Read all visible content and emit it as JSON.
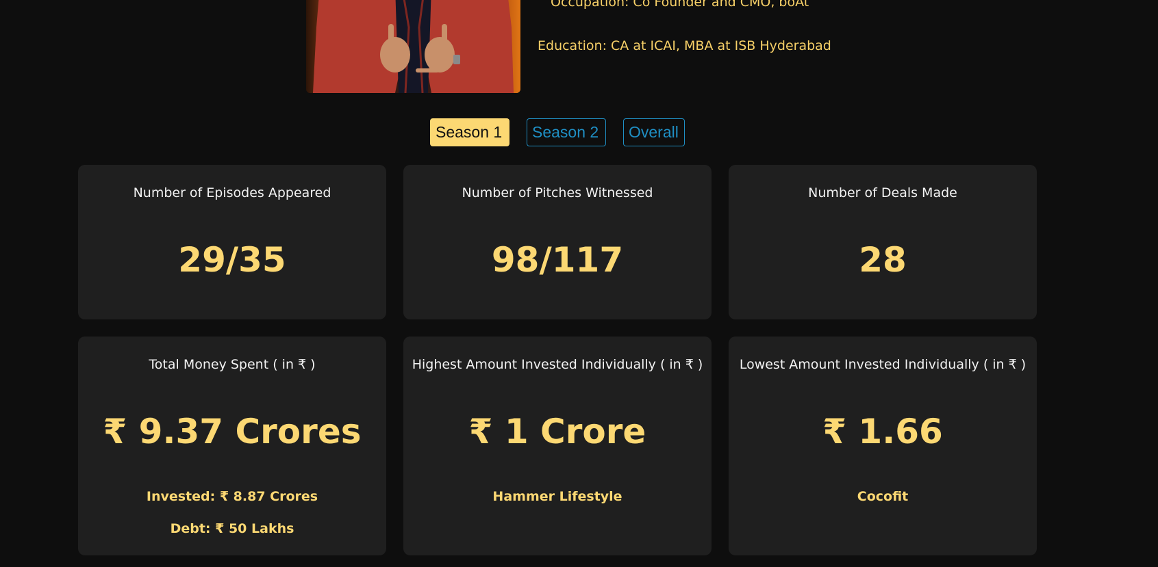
{
  "profile": {
    "occupation": "Occupation: Co Founder and CMO, boAt",
    "education": "Education: CA at ICAI, MBA at ISB Hyderabad"
  },
  "tabs": [
    {
      "label": "Season 1",
      "active": true
    },
    {
      "label": "Season 2",
      "active": false
    },
    {
      "label": "Overall",
      "active": false
    }
  ],
  "stats": [
    {
      "title": "Number of Episodes Appeared",
      "value": "29/35"
    },
    {
      "title": "Number of Pitches Witnessed",
      "value": "98/117"
    },
    {
      "title": "Number of Deals Made",
      "value": "28"
    },
    {
      "title": "Total Money Spent ( in ₹ )",
      "value": "₹ 9.37 Crores",
      "sub1": "Invested: ₹ 8.87 Crores",
      "sub2": "Debt: ₹ 50 Lakhs"
    },
    {
      "title": "Highest Amount Invested Individually ( in ₹ )",
      "value": "₹ 1 Crore",
      "sub1": "Hammer Lifestyle"
    },
    {
      "title": "Lowest Amount Invested Individually ( in ₹ )",
      "value": "₹ 1.66",
      "sub1": "Cocofit"
    }
  ],
  "colors": {
    "background": "#0e0e0e",
    "card": "#1f1f1f",
    "accent": "#fcd873",
    "link": "#1f8fc4"
  }
}
